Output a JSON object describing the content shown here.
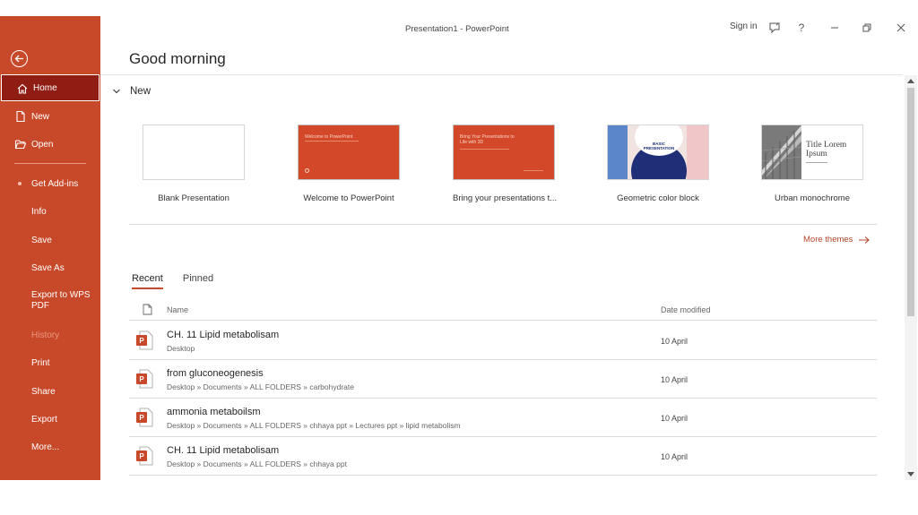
{
  "window": {
    "title": "Presentation1  -  PowerPoint",
    "sign_in": "Sign in"
  },
  "sidebar": {
    "items": [
      {
        "label": "Home",
        "icon": "home-icon",
        "state": "active"
      },
      {
        "label": "New",
        "icon": "new-file-icon",
        "state": "normal"
      },
      {
        "label": "Open",
        "icon": "folder-open-icon",
        "state": "normal"
      },
      {
        "label": "Get Add-ins",
        "icon": "dot-icon",
        "state": "normal"
      },
      {
        "label": "Info",
        "state": "normal"
      },
      {
        "label": "Save",
        "state": "normal"
      },
      {
        "label": "Save As",
        "state": "normal"
      },
      {
        "label": "Export to WPS PDF",
        "state": "normal"
      },
      {
        "label": "History",
        "state": "disabled"
      },
      {
        "label": "Print",
        "state": "normal"
      },
      {
        "label": "Share",
        "state": "normal"
      },
      {
        "label": "Export",
        "state": "normal"
      },
      {
        "label": "More...",
        "state": "normal"
      }
    ]
  },
  "main": {
    "greeting": "Good morning",
    "new_section_label": "New",
    "templates": [
      {
        "label": "Blank Presentation"
      },
      {
        "label": "Welcome to PowerPoint",
        "thumb_text": "Welcome to PowerPoint"
      },
      {
        "label": "Bring your presentations t...",
        "thumb_text": "Bring Your Presentations to Life with 3D"
      },
      {
        "label": "Geometric color block",
        "thumb_text": "BASIC PRESENTATION"
      },
      {
        "label": "Urban monochrome",
        "thumb_text": "Title Lorem Ipsum"
      }
    ],
    "more_themes": "More themes",
    "tabs": [
      {
        "label": "Recent",
        "active": true
      },
      {
        "label": "Pinned",
        "active": false
      }
    ],
    "list_headers": {
      "name": "Name",
      "date": "Date modified"
    },
    "files": [
      {
        "name": "CH. 11 Lipid metabolisam",
        "path": "Desktop",
        "date": "10 April"
      },
      {
        "name": "from gluconeogenesis",
        "path": "Desktop » Documents » ALL FOLDERS » carbohydrate",
        "date": "10 April"
      },
      {
        "name": "ammonia metaboilsm",
        "path": "Desktop » Documents » ALL FOLDERS » chhaya ppt » Lectures ppt » lipid metabolism",
        "date": "10 April"
      },
      {
        "name": "CH. 11 Lipid metabolisam",
        "path": "Desktop » Documents » ALL FOLDERS » chhaya ppt",
        "date": "10 April"
      }
    ]
  },
  "colors": {
    "sidebar_bg": "#c8492a",
    "sidebar_active": "#8f1d14",
    "accent": "#b4452a"
  }
}
